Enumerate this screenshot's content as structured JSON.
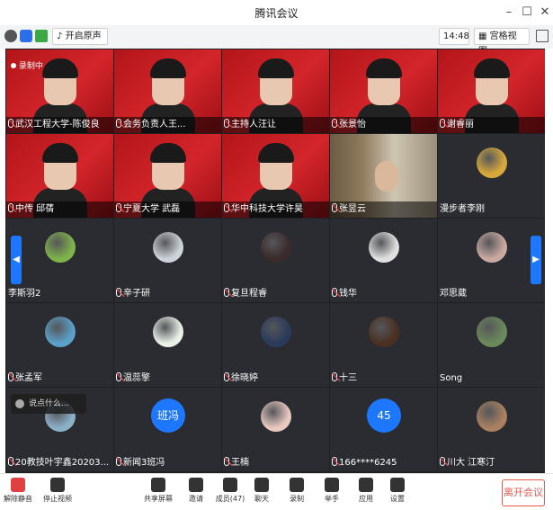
{
  "window": {
    "title": "腾讯会议",
    "minimize": "–",
    "maximize": "☐",
    "close": "✕"
  },
  "toolbar": {
    "speaker_mode": "开启原声",
    "time": "14:48",
    "view_mode": "宫格视图",
    "dropdown": "▾"
  },
  "recording": "录制中",
  "toast": "说点什么...",
  "tiles": [
    {
      "name": "武汉工程大学-陈俊良",
      "kind": "video",
      "mic": true
    },
    {
      "name": "会务负责人王...",
      "kind": "video",
      "mic": true
    },
    {
      "name": "主持人汪让",
      "kind": "video",
      "mic": true
    },
    {
      "name": "张景怡",
      "kind": "video",
      "mic": true
    },
    {
      "name": "谢睿丽",
      "kind": "video",
      "mic": true
    },
    {
      "name": "中传 邱蒨",
      "kind": "video",
      "mic": true
    },
    {
      "name": "宁夏大学 武磊",
      "kind": "video",
      "mic": true
    },
    {
      "name": "华中科技大学许昊",
      "kind": "video",
      "mic": true
    },
    {
      "name": "张昱云",
      "kind": "books",
      "mic": true
    },
    {
      "name": "漫步者李刚",
      "kind": "avatar",
      "mic": false
    },
    {
      "name": "李斯羽2",
      "kind": "avatar",
      "mic": false
    },
    {
      "name": "辛子研",
      "kind": "avatar",
      "mic": true
    },
    {
      "name": "复旦程睿",
      "kind": "avatar",
      "mic": true
    },
    {
      "name": "钱华",
      "kind": "avatar",
      "mic": true
    },
    {
      "name": "邓思葳",
      "kind": "avatar",
      "mic": false
    },
    {
      "name": "张孟军",
      "kind": "avatar",
      "mic": true
    },
    {
      "name": "温蕊擎",
      "kind": "avatar",
      "mic": true
    },
    {
      "name": "徐晓婷",
      "kind": "avatar",
      "mic": true
    },
    {
      "name": "十三",
      "kind": "avatar",
      "mic": true
    },
    {
      "name": "Song",
      "kind": "avatar",
      "mic": false
    },
    {
      "name": "20教技叶宇鑫20203...",
      "kind": "avatar",
      "mic": true
    },
    {
      "name": "新闻3班冯",
      "kind": "avatar",
      "mic": true,
      "text": "班冯"
    },
    {
      "name": "王楠",
      "kind": "avatar",
      "mic": true
    },
    {
      "name": "166****6245",
      "kind": "avatar",
      "mic": true,
      "text": "45"
    },
    {
      "name": "川大 江寒汀",
      "kind": "avatar",
      "mic": true
    }
  ],
  "avatar_colors": [
    "#d8a93a",
    "#7fb24a",
    "#cdd3da",
    "#3a2a2a",
    "#e0e0e0",
    "#c9a9a0",
    "#5aa0c8",
    "#e8f0e8",
    "#2a3a5a",
    "#4a3020",
    "#6a8a5a",
    "#8ab0c8",
    "#1e78ff",
    "#e8c8c0",
    "#1e78ff",
    "#aa8060"
  ],
  "bottombar": {
    "items": [
      {
        "label": "解除静音",
        "icon": "mic-muted-icon"
      },
      {
        "label": "停止视频",
        "icon": "camera-icon"
      },
      {
        "label": "共享屏幕",
        "icon": "share-screen-icon"
      },
      {
        "label": "邀请",
        "icon": "invite-icon"
      },
      {
        "label": "成员(47)",
        "icon": "members-icon"
      },
      {
        "label": "聊天",
        "icon": "chat-icon"
      },
      {
        "label": "录制",
        "icon": "record-icon"
      },
      {
        "label": "举手",
        "icon": "raise-hand-icon"
      },
      {
        "label": "应用",
        "icon": "apps-icon"
      },
      {
        "label": "设置",
        "icon": "settings-icon"
      }
    ],
    "leave": "离开会议"
  }
}
